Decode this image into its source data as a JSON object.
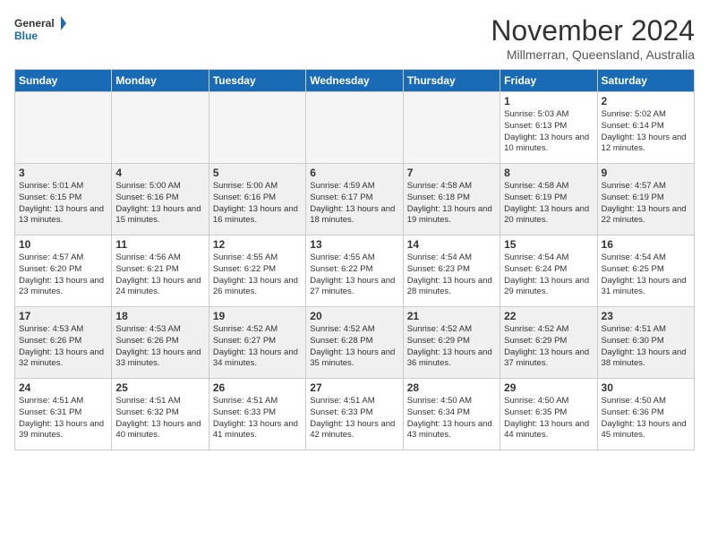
{
  "logo": {
    "line1": "General",
    "line2": "Blue"
  },
  "title": "November 2024",
  "subtitle": "Millmerran, Queensland, Australia",
  "days_of_week": [
    "Sunday",
    "Monday",
    "Tuesday",
    "Wednesday",
    "Thursday",
    "Friday",
    "Saturday"
  ],
  "weeks": [
    [
      {
        "day": "",
        "empty": true
      },
      {
        "day": "",
        "empty": true
      },
      {
        "day": "",
        "empty": true
      },
      {
        "day": "",
        "empty": true
      },
      {
        "day": "",
        "empty": true
      },
      {
        "day": "1",
        "sunrise": "5:03 AM",
        "sunset": "6:13 PM",
        "daylight": "13 hours and 10 minutes."
      },
      {
        "day": "2",
        "sunrise": "5:02 AM",
        "sunset": "6:14 PM",
        "daylight": "13 hours and 12 minutes."
      }
    ],
    [
      {
        "day": "3",
        "sunrise": "5:01 AM",
        "sunset": "6:15 PM",
        "daylight": "13 hours and 13 minutes."
      },
      {
        "day": "4",
        "sunrise": "5:00 AM",
        "sunset": "6:16 PM",
        "daylight": "13 hours and 15 minutes."
      },
      {
        "day": "5",
        "sunrise": "5:00 AM",
        "sunset": "6:16 PM",
        "daylight": "13 hours and 16 minutes."
      },
      {
        "day": "6",
        "sunrise": "4:59 AM",
        "sunset": "6:17 PM",
        "daylight": "13 hours and 18 minutes."
      },
      {
        "day": "7",
        "sunrise": "4:58 AM",
        "sunset": "6:18 PM",
        "daylight": "13 hours and 19 minutes."
      },
      {
        "day": "8",
        "sunrise": "4:58 AM",
        "sunset": "6:19 PM",
        "daylight": "13 hours and 20 minutes."
      },
      {
        "day": "9",
        "sunrise": "4:57 AM",
        "sunset": "6:19 PM",
        "daylight": "13 hours and 22 minutes."
      }
    ],
    [
      {
        "day": "10",
        "sunrise": "4:57 AM",
        "sunset": "6:20 PM",
        "daylight": "13 hours and 23 minutes."
      },
      {
        "day": "11",
        "sunrise": "4:56 AM",
        "sunset": "6:21 PM",
        "daylight": "13 hours and 24 minutes."
      },
      {
        "day": "12",
        "sunrise": "4:55 AM",
        "sunset": "6:22 PM",
        "daylight": "13 hours and 26 minutes."
      },
      {
        "day": "13",
        "sunrise": "4:55 AM",
        "sunset": "6:22 PM",
        "daylight": "13 hours and 27 minutes."
      },
      {
        "day": "14",
        "sunrise": "4:54 AM",
        "sunset": "6:23 PM",
        "daylight": "13 hours and 28 minutes."
      },
      {
        "day": "15",
        "sunrise": "4:54 AM",
        "sunset": "6:24 PM",
        "daylight": "13 hours and 29 minutes."
      },
      {
        "day": "16",
        "sunrise": "4:54 AM",
        "sunset": "6:25 PM",
        "daylight": "13 hours and 31 minutes."
      }
    ],
    [
      {
        "day": "17",
        "sunrise": "4:53 AM",
        "sunset": "6:26 PM",
        "daylight": "13 hours and 32 minutes."
      },
      {
        "day": "18",
        "sunrise": "4:53 AM",
        "sunset": "6:26 PM",
        "daylight": "13 hours and 33 minutes."
      },
      {
        "day": "19",
        "sunrise": "4:52 AM",
        "sunset": "6:27 PM",
        "daylight": "13 hours and 34 minutes."
      },
      {
        "day": "20",
        "sunrise": "4:52 AM",
        "sunset": "6:28 PM",
        "daylight": "13 hours and 35 minutes."
      },
      {
        "day": "21",
        "sunrise": "4:52 AM",
        "sunset": "6:29 PM",
        "daylight": "13 hours and 36 minutes."
      },
      {
        "day": "22",
        "sunrise": "4:52 AM",
        "sunset": "6:29 PM",
        "daylight": "13 hours and 37 minutes."
      },
      {
        "day": "23",
        "sunrise": "4:51 AM",
        "sunset": "6:30 PM",
        "daylight": "13 hours and 38 minutes."
      }
    ],
    [
      {
        "day": "24",
        "sunrise": "4:51 AM",
        "sunset": "6:31 PM",
        "daylight": "13 hours and 39 minutes."
      },
      {
        "day": "25",
        "sunrise": "4:51 AM",
        "sunset": "6:32 PM",
        "daylight": "13 hours and 40 minutes."
      },
      {
        "day": "26",
        "sunrise": "4:51 AM",
        "sunset": "6:33 PM",
        "daylight": "13 hours and 41 minutes."
      },
      {
        "day": "27",
        "sunrise": "4:51 AM",
        "sunset": "6:33 PM",
        "daylight": "13 hours and 42 minutes."
      },
      {
        "day": "28",
        "sunrise": "4:50 AM",
        "sunset": "6:34 PM",
        "daylight": "13 hours and 43 minutes."
      },
      {
        "day": "29",
        "sunrise": "4:50 AM",
        "sunset": "6:35 PM",
        "daylight": "13 hours and 44 minutes."
      },
      {
        "day": "30",
        "sunrise": "4:50 AM",
        "sunset": "6:36 PM",
        "daylight": "13 hours and 45 minutes."
      }
    ]
  ]
}
